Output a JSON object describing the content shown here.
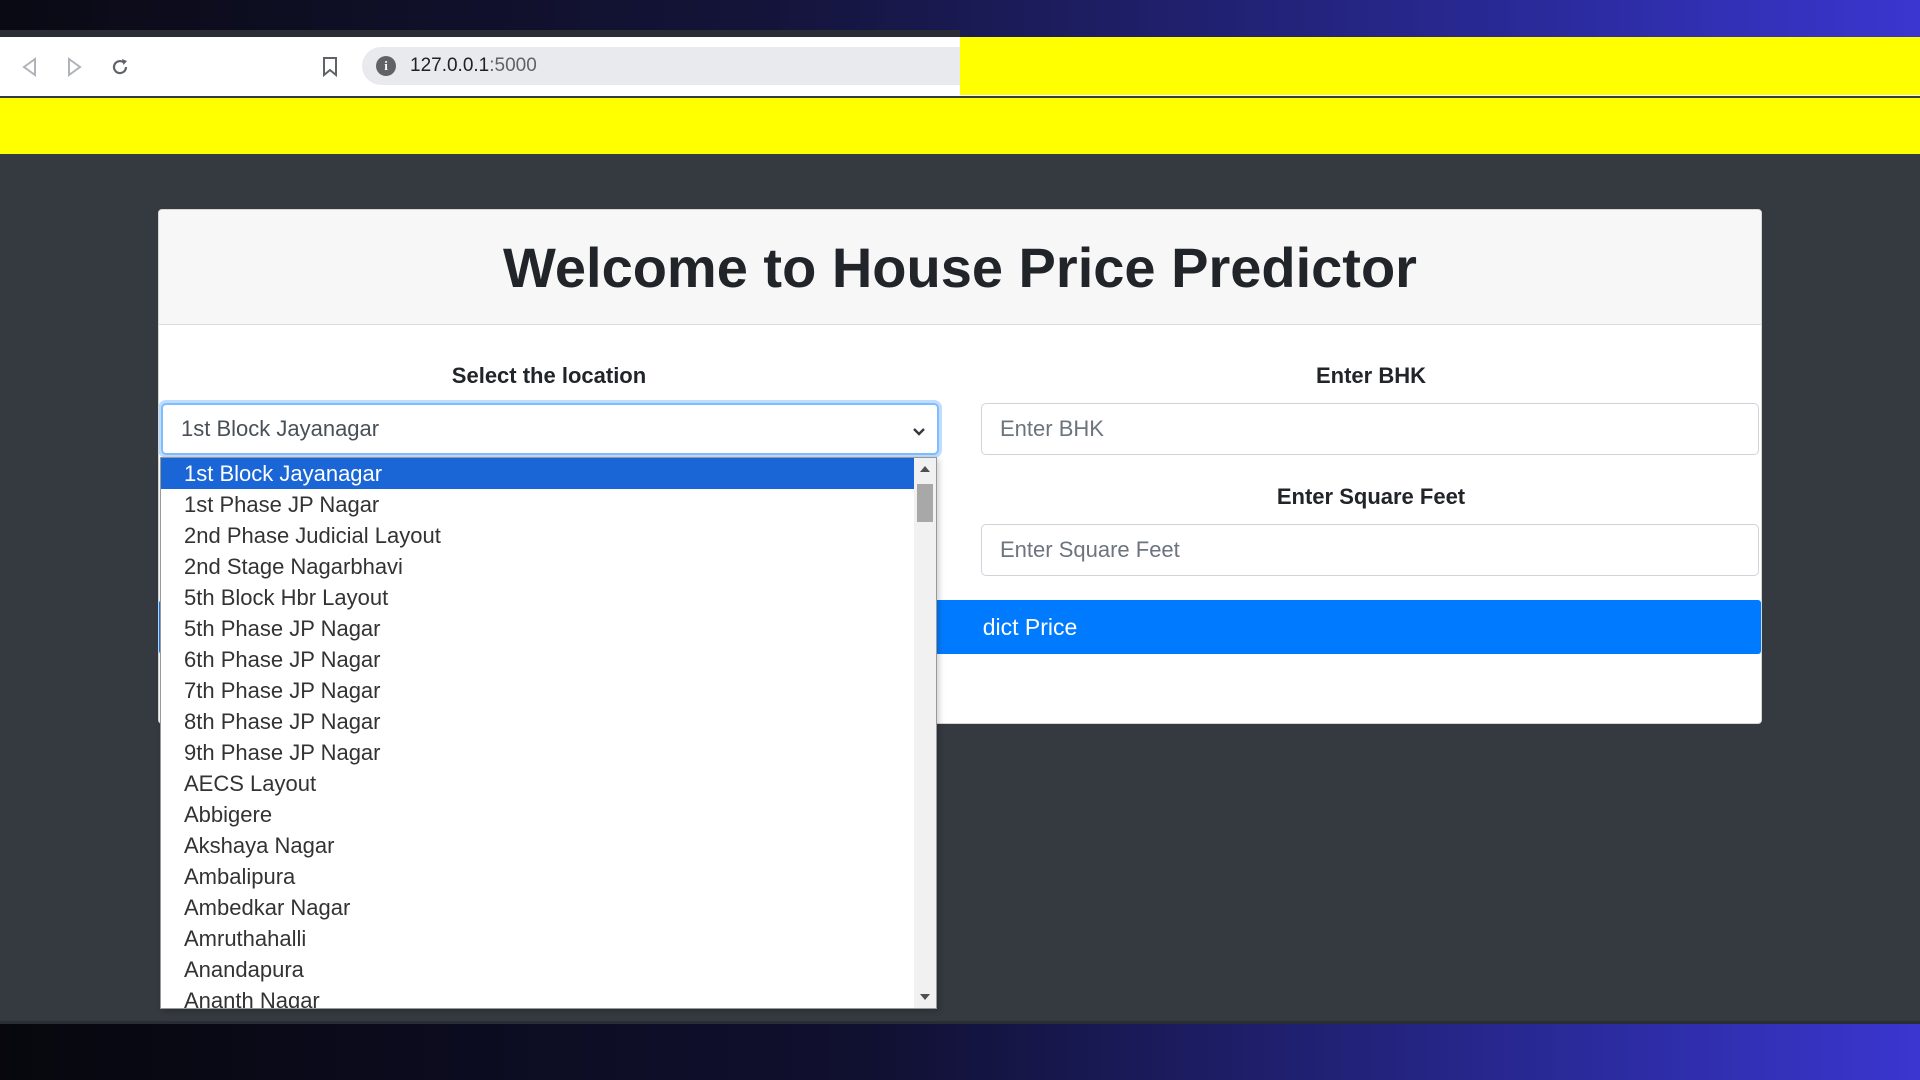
{
  "browser": {
    "url_host": "127.0.0.1",
    "url_port": ":5000",
    "icons": [
      "back-arrow-icon",
      "forward-arrow-icon",
      "reload-icon",
      "bookmark-icon",
      "info-icon"
    ]
  },
  "page": {
    "title": "Welcome to House Price Predictor",
    "location_label": "Select the location",
    "location_selected": "1st Block Jayanagar",
    "bhk_label": "Enter BHK",
    "bhk_placeholder": "Enter BHK",
    "sqft_label": "Enter Square Feet",
    "sqft_placeholder": "Enter Square Feet",
    "predict_button": "Predict Price",
    "predict_button_visible": "dict Price"
  },
  "dropdown": {
    "options": [
      "1st Block Jayanagar",
      "1st Phase JP Nagar",
      "2nd Phase Judicial Layout",
      "2nd Stage Nagarbhavi",
      "5th Block Hbr Layout",
      "5th Phase JP Nagar",
      "6th Phase JP Nagar",
      "7th Phase JP Nagar",
      "8th Phase JP Nagar",
      "9th Phase JP Nagar",
      "AECS Layout",
      "Abbigere",
      "Akshaya Nagar",
      "Ambalipura",
      "Ambedkar Nagar",
      "Amruthahalli",
      "Anandapura",
      "Ananth Nagar"
    ],
    "selected_index": 0
  },
  "colors": {
    "primary": "#007bff",
    "highlight": "#1a66d6",
    "page_bg": "#343a40",
    "yellow": "#ffff00"
  }
}
